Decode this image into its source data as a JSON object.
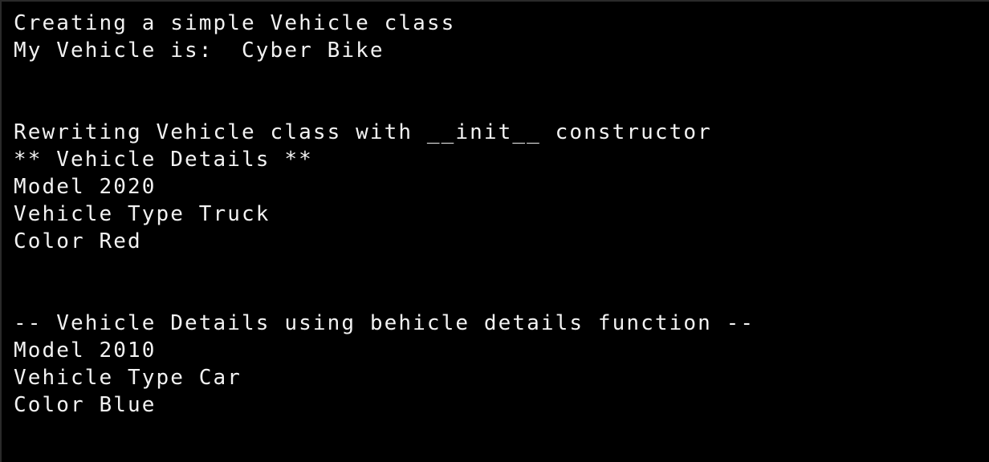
{
  "window": {
    "kind": "terminal-console-output",
    "background_color": "#000000",
    "text_color": "#f2f2f2",
    "border_color": "#2a2a2a"
  },
  "console": {
    "lines": [
      "Creating a simple Vehicle class",
      "My Vehicle is:  Cyber Bike",
      "",
      "",
      "Rewriting Vehicle class with __init__ constructor",
      "** Vehicle Details **",
      "Model 2020",
      "Vehicle Type Truck",
      "Color Red",
      "",
      "",
      "-- Vehicle Details using behicle details function --",
      "Model 2010",
      "Vehicle Type Car",
      "Color Blue"
    ]
  }
}
